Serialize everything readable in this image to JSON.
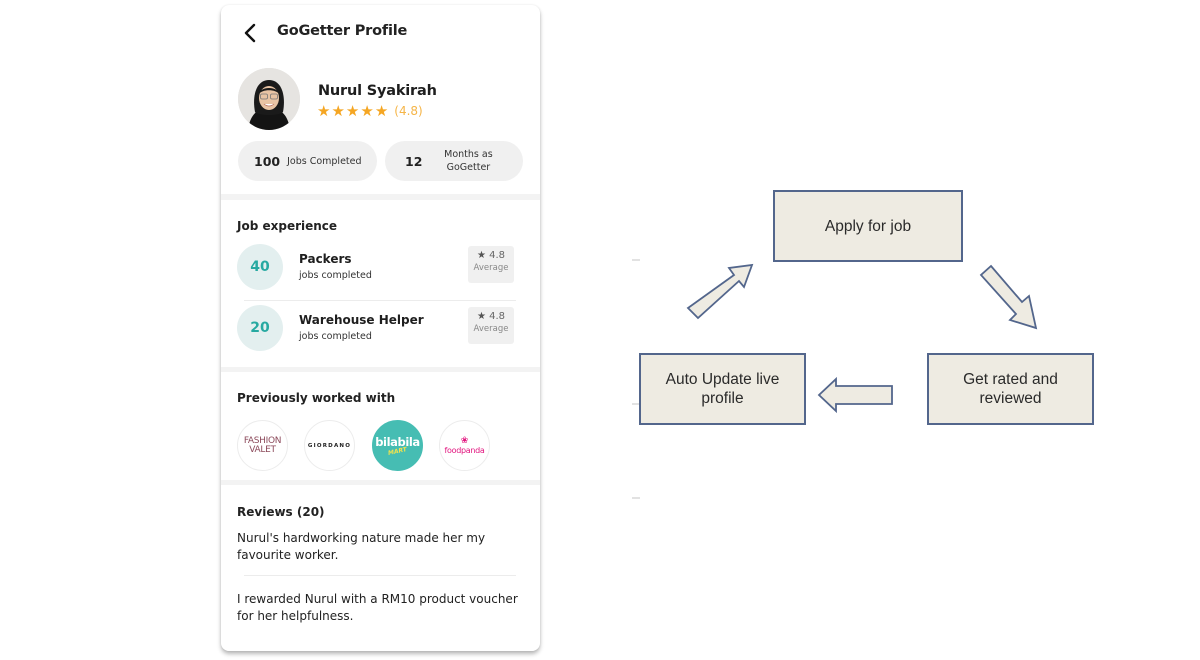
{
  "profile": {
    "title": "GoGetter Profile",
    "back_icon": "chevron-left-icon",
    "user": {
      "name": "Nurul Syakirah",
      "star_count": 5,
      "stars_filled": 5,
      "rating_text": "(4.8)",
      "rating": 4.8
    },
    "stats": [
      {
        "value": "100",
        "label": "Jobs Completed"
      },
      {
        "value": "12",
        "label": "Months as GoGetter"
      }
    ],
    "job_experience": {
      "title": "Job experience",
      "items": [
        {
          "count": "40",
          "title": "Packers",
          "subtitle": "jobs completed",
          "rating": "4.8",
          "rating_label": "Average"
        },
        {
          "count": "20",
          "title": "Warehouse Helper",
          "subtitle": "jobs completed",
          "rating": "4.8",
          "rating_label": "Average"
        }
      ]
    },
    "previously_worked_with": {
      "title": "Previously worked with",
      "brands": [
        {
          "name": "Fashion Valet",
          "line1": "FASHION",
          "line2": "VALET"
        },
        {
          "name": "Giordano",
          "text": "GIORDANO"
        },
        {
          "name": "bilabila mart",
          "text": "bilabila",
          "sub": "MART"
        },
        {
          "name": "foodpanda",
          "icon": "panda-icon",
          "text": "foodpanda"
        }
      ]
    },
    "reviews": {
      "title": "Reviews (20)",
      "items": [
        "Nurul's hardworking nature made her my favourite worker.",
        "I rewarded Nurul with a RM10 product voucher for her helpfulness."
      ]
    },
    "colors": {
      "star": "#f5a623",
      "teal": "#27a9a1",
      "bilabila": "#46bdb3",
      "foodpanda": "#e2137e"
    }
  },
  "flow": {
    "steps": [
      {
        "id": "apply",
        "label": "Apply for job"
      },
      {
        "id": "rated",
        "label": "Get rated and reviewed"
      },
      {
        "id": "update",
        "label": "Auto Update live profile"
      }
    ],
    "edges": [
      {
        "from": "apply",
        "to": "rated"
      },
      {
        "from": "rated",
        "to": "update"
      },
      {
        "from": "update",
        "to": "apply"
      }
    ],
    "colors": {
      "box_fill": "#eeebe2",
      "box_border": "#53668c"
    }
  }
}
